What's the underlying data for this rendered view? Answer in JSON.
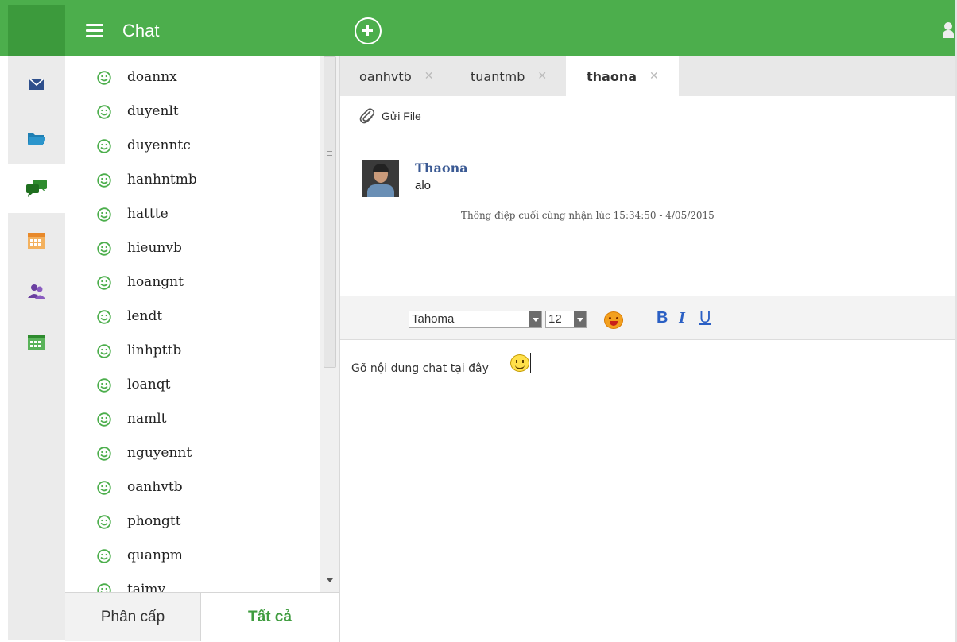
{
  "header": {
    "title": "Chat"
  },
  "contacts": [
    "doannx",
    "duyenlt",
    "duyenntc",
    "hanhntmb",
    "hattte",
    "hieunvb",
    "hoangnt",
    "lendt",
    "linhpttb",
    "loanqt",
    "namlt",
    "nguyennt",
    "oanhvtb",
    "phongtt",
    "quanpm",
    "taimv"
  ],
  "bottom_tabs": {
    "left": "Phân cấp",
    "right": "Tất cả"
  },
  "chat_tabs": [
    "oanhvtb",
    "tuantmb",
    "thaona"
  ],
  "active_tab": "thaona",
  "toolbar": {
    "send_file": "Gửi File"
  },
  "message": {
    "sender": "Thaona",
    "text": "alo",
    "last_received": "Thông điệp cuối cùng nhận lúc 15:34:50 - 4/05/2015"
  },
  "format_bar": {
    "font": "Tahoma",
    "size": "12",
    "bold": "B",
    "italic": "I",
    "underline": "U"
  },
  "compose": {
    "placeholder": "Gõ nội dung chat tại đây"
  },
  "colors": {
    "brand_green": "#4cae4c",
    "link_blue": "#3b5a94",
    "format_blue": "#2a5fc4"
  },
  "icons": [
    "menu-icon",
    "add-icon",
    "user-icon",
    "mail-icon",
    "folder-icon",
    "chat-icon",
    "calendar-icon",
    "contacts-icon",
    "calendar-grid-icon",
    "smile-icon",
    "paperclip-icon",
    "emoji-icon"
  ]
}
